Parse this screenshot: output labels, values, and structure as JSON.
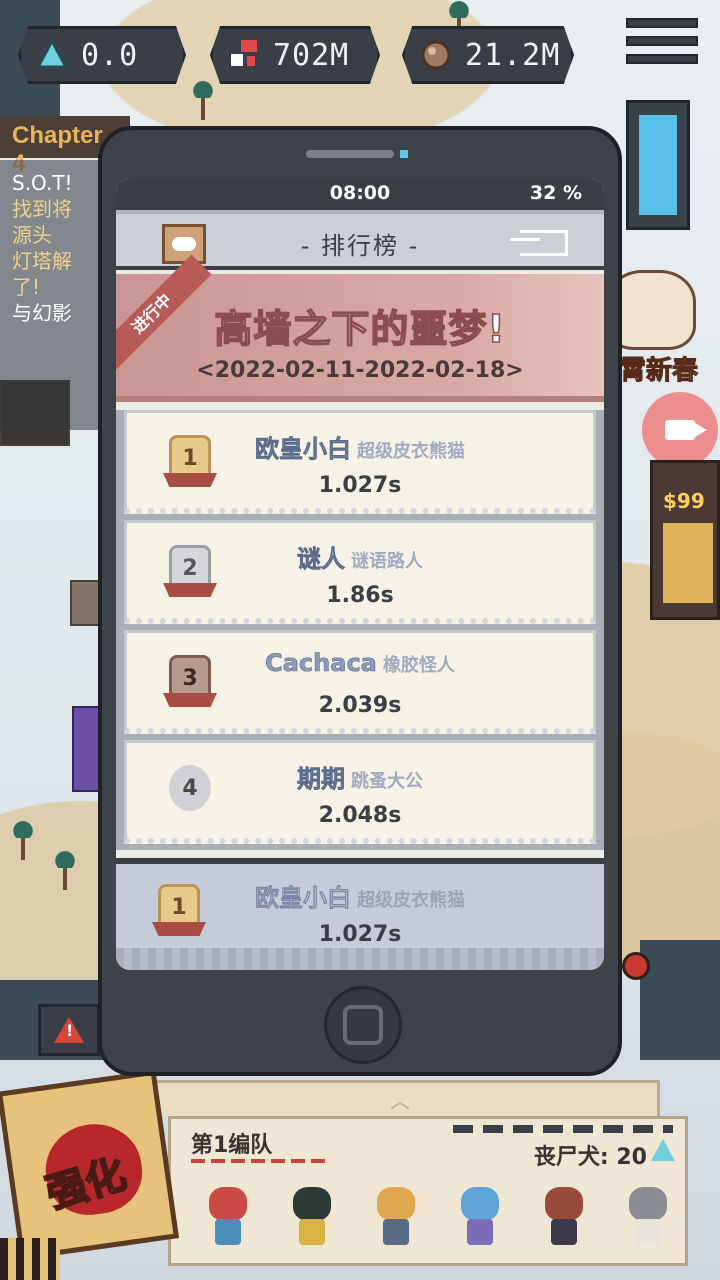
{
  "resources": [
    {
      "icon": "crystal-icon",
      "value": "0.0"
    },
    {
      "icon": "blocks-icon",
      "value": "702M"
    },
    {
      "icon": "ore-icon",
      "value": "21.2M"
    }
  ],
  "quest": {
    "chapter": "Chapter 4",
    "lines": [
      "S.O.T!",
      "找到将",
      "源头",
      "灯塔解",
      "了!",
      "与幻影"
    ]
  },
  "decor": {
    "spring_label": "霄新春",
    "vend_price": "$99"
  },
  "phone": {
    "status_time": "08:00",
    "status_battery": "32 %",
    "title": "- 排行榜 -",
    "event": {
      "ribbon": "进行中",
      "title": "高墙之下的噩梦!",
      "dates": "<2022-02-11-2022-02-18>"
    },
    "rankings": [
      {
        "rank": "1",
        "name": "欧皇小白",
        "sub": "超级皮衣熊猫",
        "time": "1.027s"
      },
      {
        "rank": "2",
        "name": "谜人",
        "sub": "谜语路人",
        "time": "1.86s"
      },
      {
        "rank": "3",
        "name": "Cachaca",
        "sub": "橡胶怪人",
        "time": "2.039s"
      },
      {
        "rank": "4",
        "name": "期期",
        "sub": "跳蚤大公",
        "time": "2.048s"
      }
    ],
    "my_rank": {
      "rank": "1",
      "name": "欧皇小白",
      "sub": "超级皮衣熊猫",
      "time": "1.027s"
    }
  },
  "squad": {
    "title": "第1编队",
    "count_label": "丧尸犬: 20",
    "heroes": [
      {
        "name": "hero-1",
        "head": "#c94b43",
        "body": "#4a8fb8"
      },
      {
        "name": "hero-2",
        "head": "#2c3a36",
        "body": "#d8b343"
      },
      {
        "name": "hero-3",
        "head": "#e0a94e",
        "body": "#5b6a86"
      },
      {
        "name": "hero-4",
        "head": "#5fa4d8",
        "body": "#7a6db5"
      },
      {
        "name": "hero-5",
        "head": "#9a4a3a",
        "body": "#3a3a4a"
      },
      {
        "name": "hero-6",
        "head": "#8a8d94",
        "body": "#e8e4dc"
      }
    ]
  },
  "boost_label": "强化",
  "colors": {
    "accent_red": "#b8282a",
    "phone_body": "#3e4249",
    "banner": "#c99693",
    "name_blue": "#8a9bbd"
  }
}
